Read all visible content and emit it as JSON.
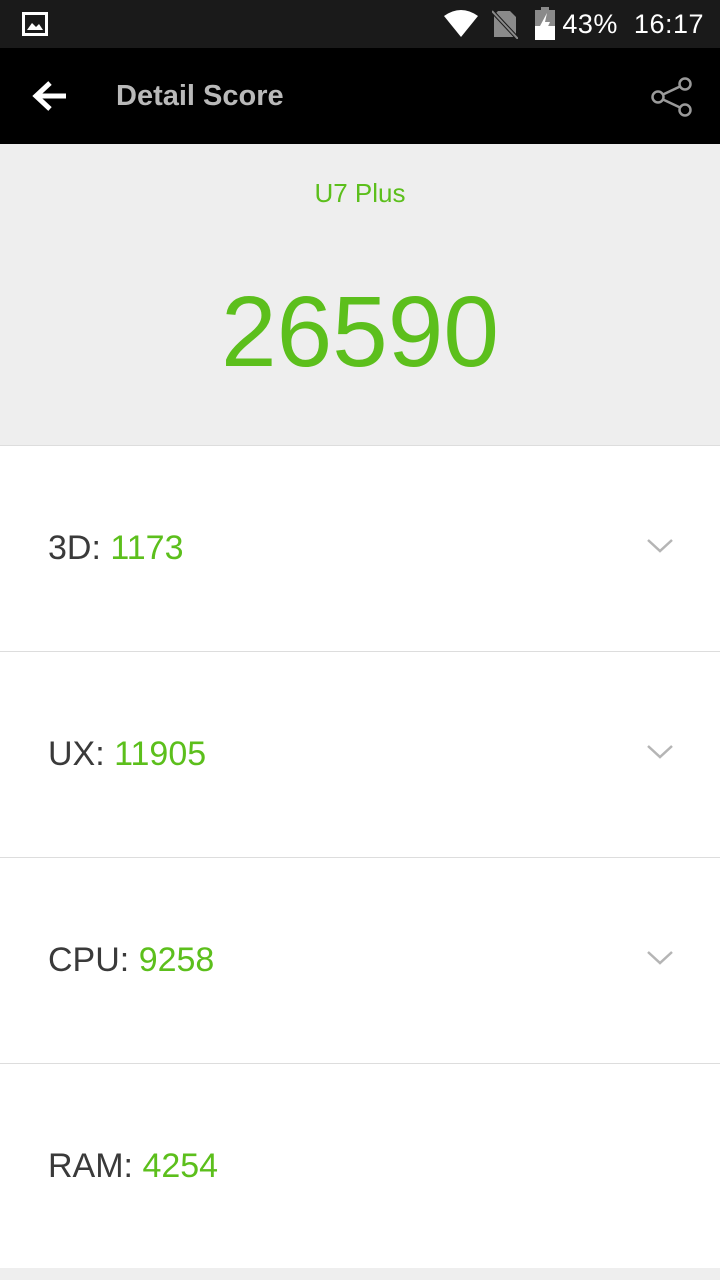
{
  "status_bar": {
    "battery_percent": "43%",
    "time": "16:17",
    "icons": [
      "gallery-icon",
      "wifi-icon",
      "no-sim-icon",
      "battery-charging-icon"
    ]
  },
  "app_bar": {
    "title": "Detail Score",
    "icons": [
      "back-arrow-icon",
      "share-icon"
    ]
  },
  "summary": {
    "device_name": "U7 Plus",
    "total_score": "26590"
  },
  "scores": [
    {
      "label": "3D: ",
      "value": "1173",
      "expandable": true
    },
    {
      "label": "UX: ",
      "value": "11905",
      "expandable": true
    },
    {
      "label": "CPU: ",
      "value": "9258",
      "expandable": true
    },
    {
      "label": "RAM: ",
      "value": "4254",
      "expandable": false
    }
  ],
  "colors": {
    "accent": "#5cbf1c",
    "app_bar": "#000000",
    "summary_bg": "#eeeeee"
  }
}
